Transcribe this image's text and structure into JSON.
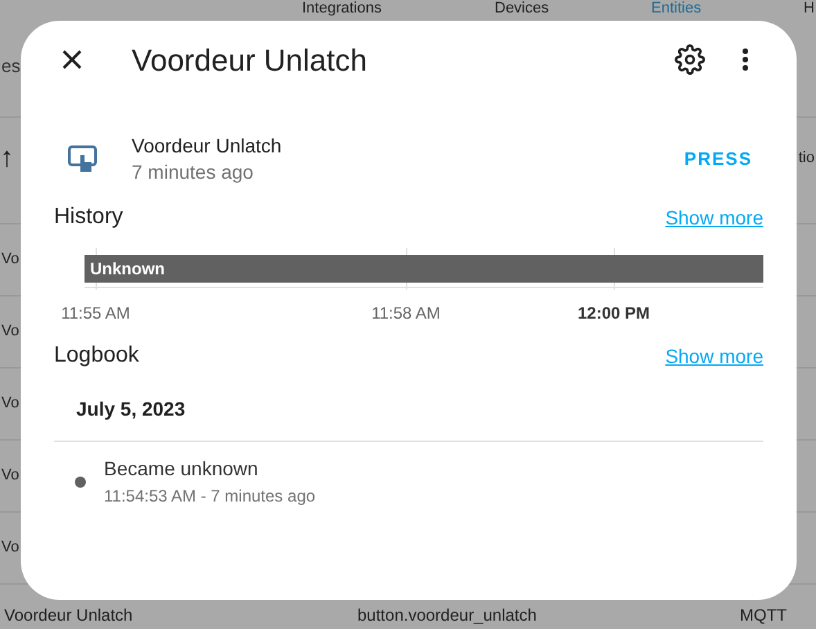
{
  "background_page": {
    "tabs": [
      {
        "label": "Integrations",
        "selected": false
      },
      {
        "label": "Devices",
        "selected": false
      },
      {
        "label": "Entities",
        "selected": true
      },
      {
        "label": "H",
        "selected": false
      }
    ],
    "search_fragment": "es",
    "sort_arrow": "↑",
    "column_fragment": "tio",
    "row_fragments": [
      "Vo",
      "Vo",
      "Vo",
      "Vo",
      "Vo"
    ],
    "last_row": {
      "name": "Voordeur Unlatch",
      "entity_id": "button.voordeur_unlatch",
      "integration": "MQTT"
    }
  },
  "dialog": {
    "title": "Voordeur Unlatch",
    "entity": {
      "name": "Voordeur Unlatch",
      "last_changed": "7 minutes ago",
      "action": "PRESS"
    },
    "history": {
      "title": "History",
      "show_more": "Show more",
      "state_label": "Unknown",
      "ticks": [
        {
          "label": "11:55 AM",
          "bold": false
        },
        {
          "label": "11:58 AM",
          "bold": false
        },
        {
          "label": "12:00 PM",
          "bold": true
        }
      ]
    },
    "logbook": {
      "title": "Logbook",
      "show_more": "Show more",
      "date": "July 5, 2023",
      "entries": [
        {
          "message": "Became unknown",
          "time": "11:54:53 AM - 7 minutes ago"
        }
      ]
    }
  }
}
